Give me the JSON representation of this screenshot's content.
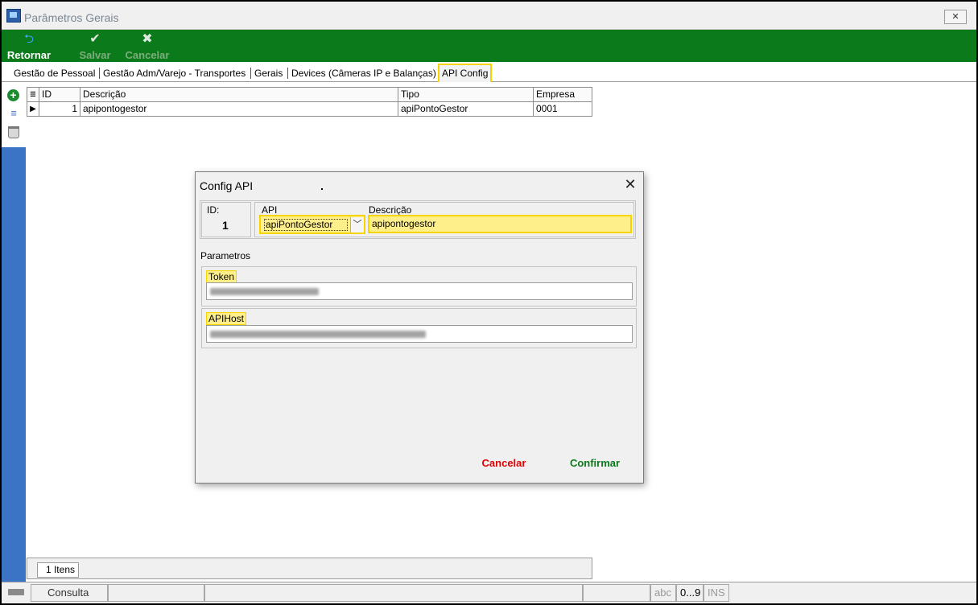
{
  "window": {
    "title": "Parâmetros Gerais",
    "close_symbol": "✕"
  },
  "toolbar": {
    "retornar": {
      "label": "Retornar",
      "icon": "back-arrow-icon"
    },
    "salvar": {
      "label": "Salvar",
      "icon": "check-icon"
    },
    "cancelar": {
      "label": "Cancelar",
      "icon": "cancel-x-icon"
    }
  },
  "tabs": [
    {
      "label": "Gestão de Pessoal"
    },
    {
      "label": "Gestão Adm/Varejo - Transportes"
    },
    {
      "label": "Gerais"
    },
    {
      "label": "Devices (Câmeras IP e Balanças)"
    },
    {
      "label": "API Config",
      "active": true
    }
  ],
  "grid": {
    "columns": [
      "ID",
      "Descrição",
      "Tipo",
      "Empresa"
    ],
    "rows": [
      {
        "id": "1",
        "descricao": "apipontogestor",
        "tipo": "apiPontoGestor",
        "empresa": "0001"
      }
    ],
    "items_count": "1 Itens"
  },
  "status_bar": {
    "mode": "Consulta",
    "abc": "abc",
    "digits": "0...9",
    "ins": "INS"
  },
  "dialog": {
    "title": "Config API",
    "close_symbol": "✕",
    "id_label": "ID:",
    "id_value": "1",
    "api_label": "API",
    "api_value": "apiPontoGestor",
    "desc_label": "Descrição",
    "desc_value": "apipontogestor",
    "parametros_label": "Parametros",
    "token_label": "Token",
    "apihost_label": "APIHost",
    "cancel_label": "Cancelar",
    "confirm_label": "Confirmar"
  },
  "colors": {
    "toolbar_green": "#0a7a1a",
    "highlight_yellow": "#f5d400",
    "cancel_red": "#e00000",
    "sidebar_blue": "#3b74c4"
  }
}
